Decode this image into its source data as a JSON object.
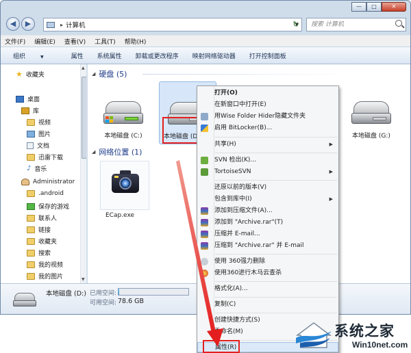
{
  "window": {
    "title_controls": {
      "minimize": "—",
      "maximize": "□",
      "close": "✕"
    },
    "address": {
      "segment": "计算机",
      "separator": "▸"
    },
    "search": {
      "placeholder": "搜索 计算机"
    }
  },
  "menubar": [
    {
      "label": "文件(F)"
    },
    {
      "label": "编辑(E)"
    },
    {
      "label": "查看(V)"
    },
    {
      "label": "工具(T)"
    },
    {
      "label": "帮助(H)"
    }
  ],
  "toolbar": [
    {
      "label": "组织"
    },
    {
      "label": "属性"
    },
    {
      "label": "系统属性"
    },
    {
      "label": "卸载或更改程序"
    },
    {
      "label": "映射网络驱动器"
    },
    {
      "label": "打开控制面板"
    }
  ],
  "nav": {
    "favorites": "收藏夹",
    "desktop": "桌面",
    "library": "库",
    "videos": "视频",
    "pictures": "图片",
    "documents": "文档",
    "thunder": "迅雷下载",
    "music": "音乐",
    "admin": "Administrator",
    "android": ".android",
    "saved_games": "保存的游戏",
    "contacts": "联系人",
    "links": "链接",
    "favorites2": "收藏夹",
    "searches": "搜索",
    "my_videos": "我的视频",
    "my_pictures": "我的图片"
  },
  "content": {
    "hdd_group": "硬盘 (5)",
    "net_group": "网络位置 (1)",
    "drive_c": "本地磁盘 (C:)",
    "drive_d": "本地磁盘 (D",
    "drive_g": "本地磁盘 (G:)",
    "ecap": "ECap.exe"
  },
  "details": {
    "name": "本地磁盘 (D:)",
    "used_label": "已用空间:",
    "free_label": "可用空间:",
    "free_value": "78.6 GB",
    "used_fraction": 0.01
  },
  "context_menu": {
    "open": "打开(O)",
    "open_new": "在新窗口中打开(E)",
    "wise": "用Wise Folder Hider隐藏文件夹",
    "bitlocker": "启用 BitLocker(B)...",
    "share": "共享(H)",
    "svn_checkout": "SVN 检出(K)...",
    "tortoise": "TortoiseSVN",
    "restore": "还原以前的版本(V)",
    "include": "包含到库中(I)",
    "add_archive": "添加到压缩文件(A)...",
    "add_rar": "添加到 \"Archive.rar\"(T)",
    "compress_email": "压缩并 E-mail...",
    "compress_rar_email": "压缩到 \"Archive.rar\" 并 E-mail",
    "del360": "使用 360强力删除",
    "scan360": "使用360进行木马云查杀",
    "format": "格式化(A)...",
    "copy": "复制(C)",
    "shortcut": "创建快捷方式(S)",
    "rename": "重命名(M)",
    "properties": "属性(R)"
  },
  "watermark": {
    "title": "系统之家",
    "site": "Win10net.com"
  },
  "colors": {
    "accent_red": "#e41e1e",
    "selection": "#d7e7f9",
    "header_blue": "#1e3b8a"
  }
}
